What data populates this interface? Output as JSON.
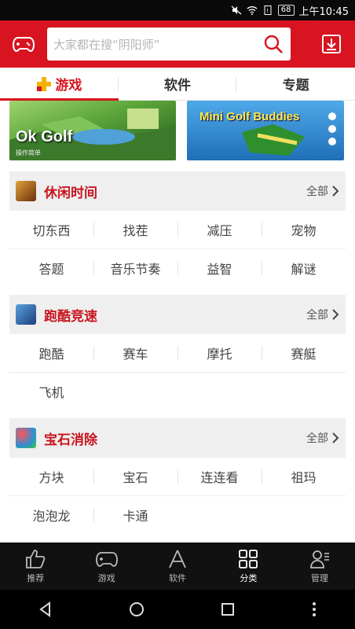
{
  "status_bar": {
    "battery": "68",
    "time": "上午10:45"
  },
  "header": {
    "search_placeholder": "大家都在搜“阴阳师”"
  },
  "tabs": [
    {
      "label": "游戏",
      "active": true
    },
    {
      "label": "软件",
      "active": false
    },
    {
      "label": "专题",
      "active": false
    }
  ],
  "banners": [
    {
      "title": "Ok Golf",
      "caption": "操作简单"
    },
    {
      "title": "Mini Golf Buddies"
    }
  ],
  "categories": [
    {
      "title": "休闲时间",
      "all_label": "全部",
      "icon_color": "#8b4a1c",
      "rows": [
        [
          "切东西",
          "找茬",
          "减压",
          "宠物"
        ],
        [
          "答题",
          "音乐节奏",
          "益智",
          "解谜"
        ]
      ]
    },
    {
      "title": "跑酷竞速",
      "all_label": "全部",
      "icon_color": "#2f5fa8",
      "rows": [
        [
          "跑酷",
          "赛车",
          "摩托",
          "赛艇"
        ],
        [
          "飞机"
        ]
      ]
    },
    {
      "title": "宝石消除",
      "all_label": "全部",
      "icon_color": "#2e8fd6",
      "rows": [
        [
          "方块",
          "宝石",
          "连连看",
          "祖玛"
        ],
        [
          "泡泡龙",
          "卡通"
        ]
      ]
    }
  ],
  "bottom_nav": [
    {
      "label": "推荐",
      "icon": "thumbs-up-icon"
    },
    {
      "label": "游戏",
      "icon": "gamepad-icon"
    },
    {
      "label": "软件",
      "icon": "app-store-icon"
    },
    {
      "label": "分类",
      "icon": "grid-icon",
      "active": true
    },
    {
      "label": "管理",
      "icon": "user-manage-icon"
    }
  ],
  "colors": {
    "brand_red": "#d7141f",
    "title_red": "#c8161e"
  }
}
